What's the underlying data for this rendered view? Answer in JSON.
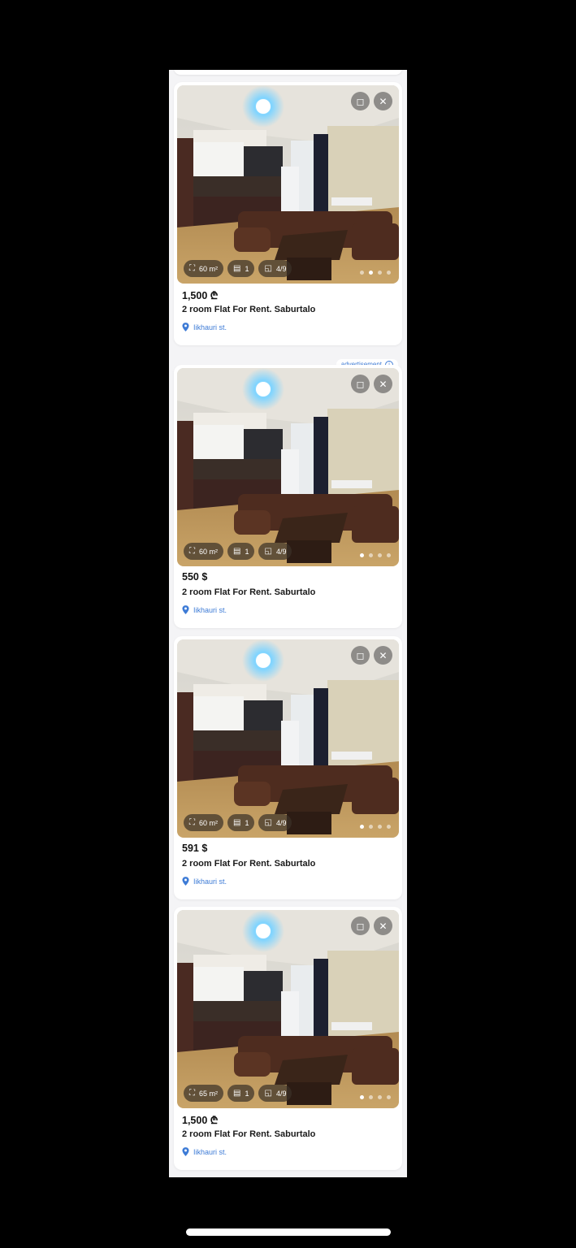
{
  "ad_label": "advertisement",
  "listings": [
    {
      "price": "1,500 ₾",
      "title": "2 room Flat For Rent. Saburtalo",
      "address": "Iikhauri st.",
      "area": "60 m²",
      "bedrooms": "1",
      "floor": "4/9",
      "active_photo": 1,
      "photo_count": 4
    },
    {
      "price": "550 $",
      "title": "2 room Flat For Rent. Saburtalo",
      "address": "Iikhauri st.",
      "area": "60 m²",
      "bedrooms": "1",
      "floor": "4/9",
      "active_photo": 0,
      "photo_count": 4
    },
    {
      "price": "591 $",
      "title": "2 room Flat For Rent. Saburtalo",
      "address": "Iikhauri st.",
      "area": "60 m²",
      "bedrooms": "1",
      "floor": "4/9",
      "active_photo": 0,
      "photo_count": 4
    },
    {
      "price": "1,500 ₾",
      "title": "2 room Flat For Rent. Saburtalo",
      "address": "Iikhauri st.",
      "area": "65 m²",
      "bedrooms": "1",
      "floor": "4/9",
      "active_photo": 0,
      "photo_count": 4
    }
  ],
  "icons": {
    "save": "bookmark-icon",
    "close": "close-icon",
    "area": "expand-icon",
    "bedrooms": "bed-icon",
    "floor": "stairs-icon",
    "address": "location-pin-icon",
    "ad_info": "info-icon"
  },
  "colors": {
    "link": "#3d7bd6",
    "chip_bg": "#3c3228",
    "background": "#f4f4f6"
  }
}
